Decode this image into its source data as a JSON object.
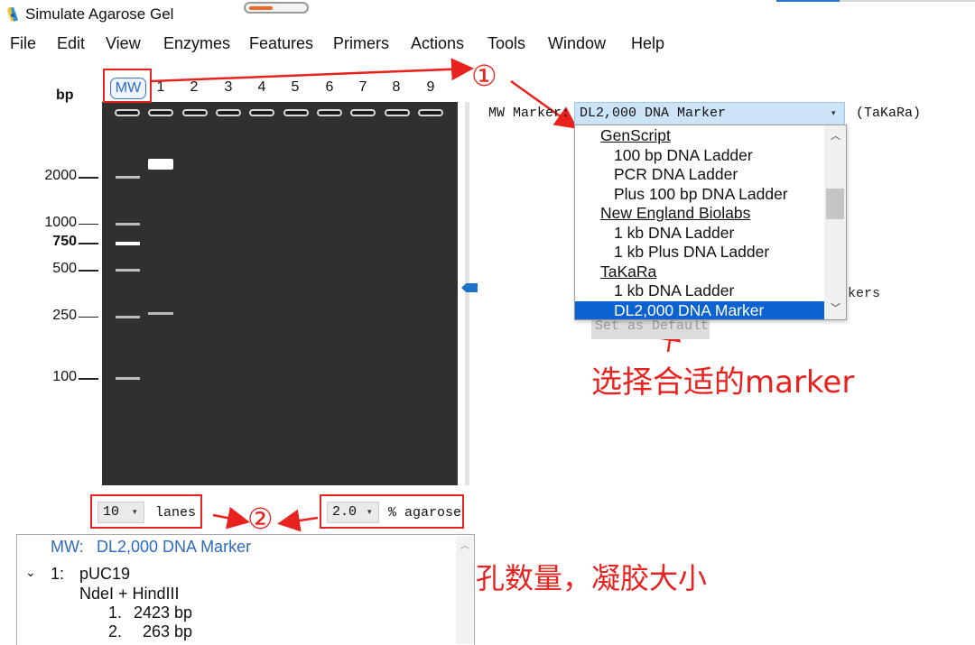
{
  "window": {
    "title": "Simulate Agarose Gel",
    "progress_fraction": 0.42,
    "accent_color": "#2e74d4"
  },
  "menu": [
    "File",
    "Edit",
    "View",
    "Enzymes",
    "Features",
    "Primers",
    "Actions",
    "Tools",
    "Window",
    "Help"
  ],
  "gel": {
    "unit_label": "bp",
    "mw_lane_label": "MW",
    "lanes": [
      "1",
      "2",
      "3",
      "4",
      "5",
      "6",
      "7",
      "8",
      "9"
    ],
    "marker_labels": [
      {
        "bp": 2000,
        "text": "2000",
        "bold": false
      },
      {
        "bp": 1000,
        "text": "1000",
        "bold": false
      },
      {
        "bp": 750,
        "text": "750",
        "bold": true
      },
      {
        "bp": 500,
        "text": "500",
        "bold": false
      },
      {
        "bp": 250,
        "text": "250",
        "bold": false
      },
      {
        "bp": 100,
        "text": "100",
        "bold": false
      }
    ],
    "ladder_bands_bp": [
      2000,
      1000,
      750,
      500,
      250,
      100
    ],
    "sample_bands_bp": [
      2423,
      263
    ],
    "gel_color": "#303030"
  },
  "controls": {
    "lanes_value": "10",
    "lanes_label": "lanes",
    "agarose_value": "2.0",
    "agarose_label": "% agarose"
  },
  "mw_marker": {
    "label": "MW Marker:",
    "selected": "DL2,000 DNA Marker",
    "vendor": "(TaKaRa)",
    "partial_text": "rkers",
    "set_default": "Set as Default",
    "options": [
      {
        "text": "GenScript",
        "group": true
      },
      {
        "text": "100 bp DNA Ladder",
        "group": false
      },
      {
        "text": "PCR DNA Ladder",
        "group": false
      },
      {
        "text": "Plus 100 bp DNA Ladder",
        "group": false
      },
      {
        "text": "New England Biolabs",
        "group": true
      },
      {
        "text": "1 kb DNA Ladder",
        "group": false
      },
      {
        "text": "1 kb Plus DNA Ladder",
        "group": false
      },
      {
        "text": "TaKaRa",
        "group": true
      },
      {
        "text": "1 kb DNA Ladder",
        "group": false
      },
      {
        "text": "DL2,000 DNA Marker",
        "group": false,
        "selected": true
      }
    ]
  },
  "info": {
    "mw_line_prefix": "MW:",
    "mw_line_value": "DL2,000 DNA Marker",
    "sample_index": "1:",
    "sample_name": "pUC19",
    "enzymes": "NdeI + HindIII",
    "fragments": [
      {
        "index": "1.",
        "size": "2423 bp"
      },
      {
        "index": "2.",
        "size": "263 bp"
      }
    ]
  },
  "annotations": {
    "num1": "①",
    "num2": "②",
    "choose_marker": "选择合适的marker",
    "adjust_note": "根据需求调整梳孔数量，凝胶大小",
    "color": "#e8231f"
  }
}
